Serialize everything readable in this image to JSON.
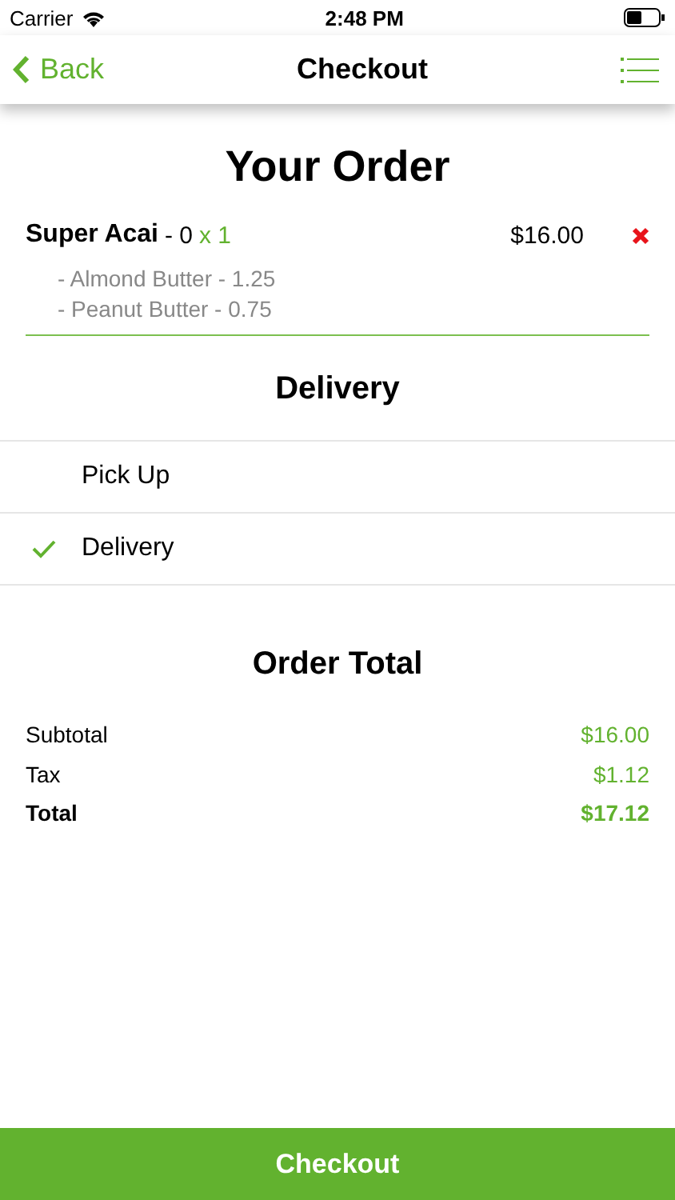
{
  "status_bar": {
    "carrier": "Carrier",
    "time": "2:48 PM"
  },
  "nav": {
    "back": "Back",
    "title": "Checkout"
  },
  "order": {
    "heading": "Your Order",
    "items": [
      {
        "name": "Super Acai",
        "detail": "- 0",
        "quantity": "x 1",
        "price": "$16.00",
        "extras": [
          "- Almond Butter - 1.25",
          "- Peanut Butter - 0.75"
        ]
      }
    ]
  },
  "delivery": {
    "heading": "Delivery",
    "options": [
      {
        "label": "Pick Up",
        "selected": false
      },
      {
        "label": "Delivery",
        "selected": true
      }
    ]
  },
  "totals": {
    "heading": "Order Total",
    "rows": [
      {
        "kind": "line",
        "label": "Subtotal",
        "value": "$16.00"
      },
      {
        "kind": "line",
        "label": "Tax",
        "value": "$1.12"
      },
      {
        "kind": "total",
        "label": "Total",
        "value": "$17.12"
      }
    ]
  },
  "checkout_button": "Checkout"
}
